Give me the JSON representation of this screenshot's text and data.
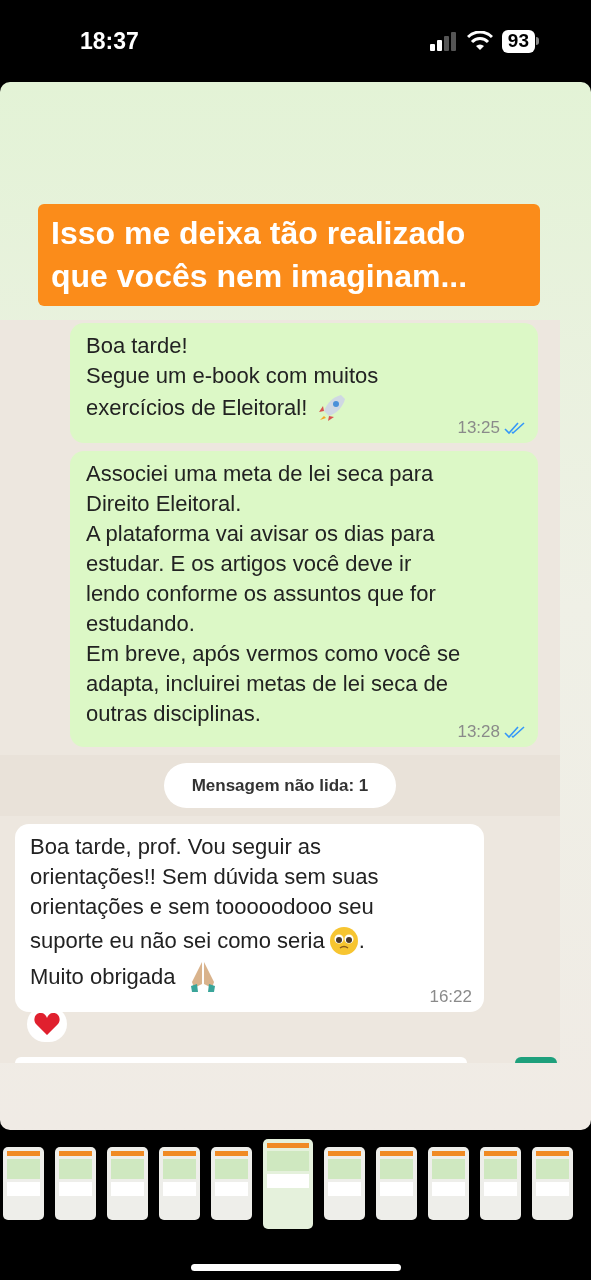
{
  "status_bar": {
    "time": "18:37",
    "battery": "93"
  },
  "caption": {
    "lines": [
      "Isso me deixa tão realizado",
      "que vocês nem imaginam..."
    ]
  },
  "chat": {
    "messages": [
      {
        "kind": "outgoing",
        "lines": [
          {
            "text": "Boa tarde!"
          },
          {
            "text": "Segue um e-book com muitos"
          },
          {
            "text": "exercícios de Eleitoral!",
            "kind": "rocket"
          }
        ],
        "time": "13:25",
        "read": true
      },
      {
        "kind": "outgoing",
        "lines": [
          {
            "text": "Associei uma meta de lei seca para"
          },
          {
            "text": "Direito Eleitoral."
          },
          {
            "text": "A plataforma vai avisar os dias para"
          },
          {
            "text": "estudar. E os artigos você deve ir"
          },
          {
            "text": "lendo conforme os assuntos que for"
          },
          {
            "text": "estudando."
          },
          {
            "text": "Em breve, após vermos como você se"
          },
          {
            "text": "adapta, incluirei metas de lei seca de"
          },
          {
            "text": "outras disciplinas."
          }
        ],
        "time": "13:28",
        "read": true
      },
      {
        "kind": "unread",
        "text": "Mensagem não lida: 1"
      },
      {
        "kind": "incoming",
        "lines": [
          {
            "text": "Boa tarde, prof. Vou seguir as"
          },
          {
            "text": "orientações!! Sem dúvida sem suas"
          },
          {
            "text": "orientações e sem tooooodooo seu"
          },
          {
            "text": "suporte eu não sei como seria",
            "kind": "pleading",
            "after": "."
          },
          {
            "text": "Muito obrigada",
            "kind": "pray"
          }
        ],
        "time": "16:22",
        "reaction": {
          "kind": "heart"
        }
      }
    ]
  },
  "thumbnails": [
    {
      "selected": false
    },
    {
      "selected": false
    },
    {
      "selected": false
    },
    {
      "selected": false
    },
    {
      "selected": false
    },
    {
      "selected": true
    },
    {
      "selected": false
    },
    {
      "selected": false
    },
    {
      "selected": false
    },
    {
      "selected": false
    },
    {
      "selected": false
    }
  ]
}
